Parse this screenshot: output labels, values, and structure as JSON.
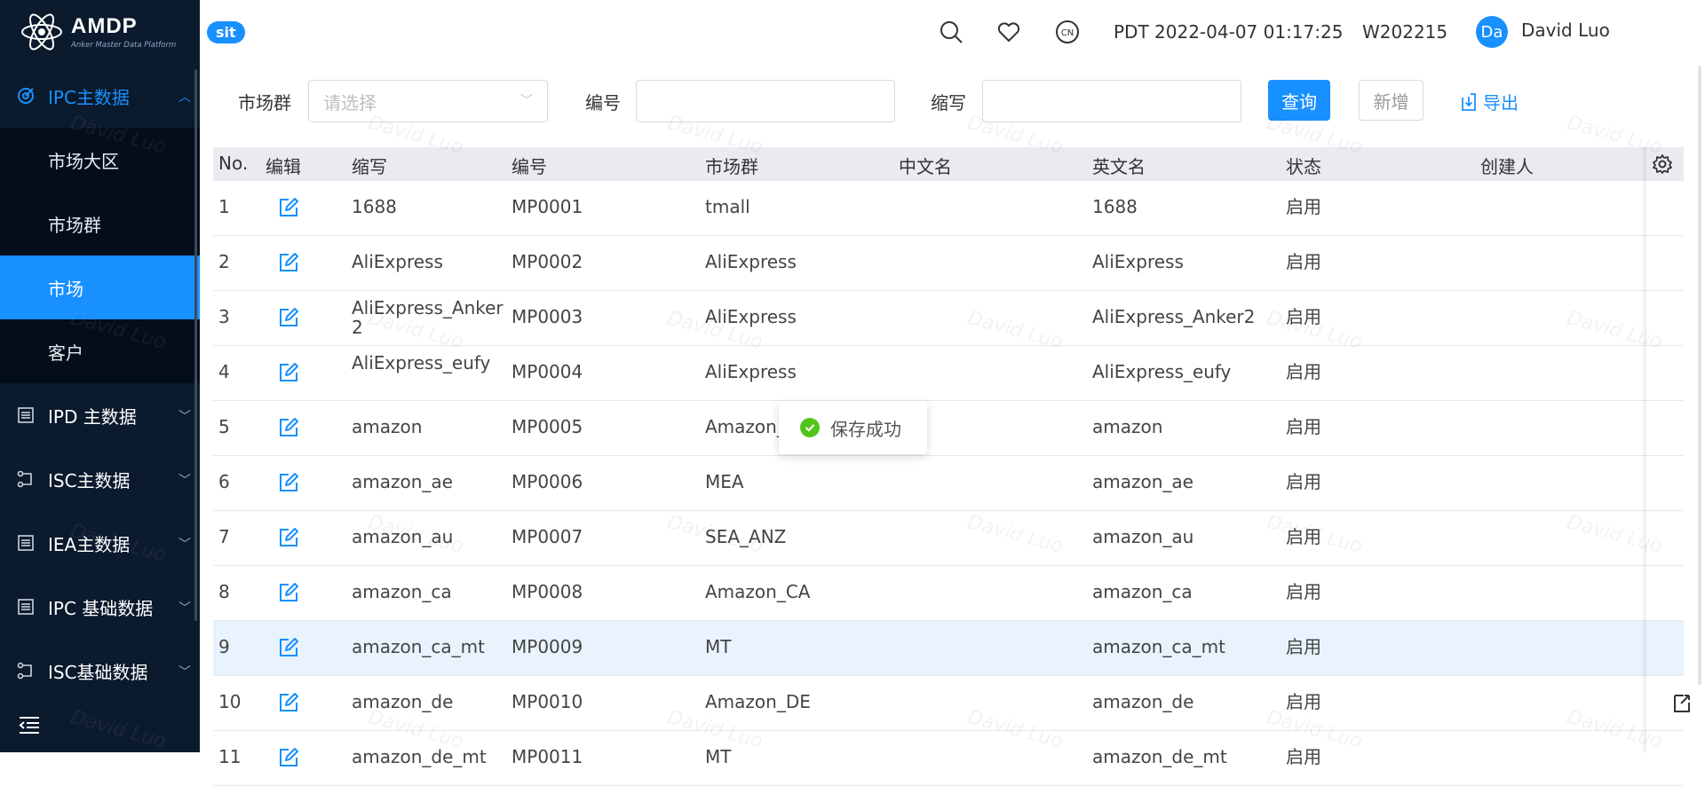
{
  "app": {
    "logo_title": "AMDP",
    "logo_subtitle": "Anker Master Data Platform",
    "env_badge": "sit",
    "accent_color": "#1890ff",
    "sidebar_bg": "#0b1a2c"
  },
  "header": {
    "datetime": "PDT 2022-04-07 01:17:25",
    "week": "W202215",
    "avatar_initials": "Da",
    "user_name": "David Luo",
    "lang_icon_text": "CN"
  },
  "sidebar": {
    "groups": [
      {
        "label": "IPC主数据",
        "icon": "target-icon",
        "expanded": true
      },
      {
        "label": "IPD 主数据",
        "icon": "list-icon"
      },
      {
        "label": "ISC主数据",
        "icon": "flow-icon"
      },
      {
        "label": "IEA主数据",
        "icon": "list-icon"
      },
      {
        "label": "IPC 基础数据",
        "icon": "list-icon"
      },
      {
        "label": "ISC基础数据",
        "icon": "flow-icon"
      }
    ],
    "sub_items": [
      {
        "label": "市场大区"
      },
      {
        "label": "市场群"
      },
      {
        "label": "市场",
        "selected": true
      },
      {
        "label": "客户"
      }
    ]
  },
  "filters": {
    "market_group_label": "市场群",
    "market_group_placeholder": "请选择",
    "code_label": "编号",
    "code_value": "",
    "abbr_label": "缩写",
    "abbr_value": "",
    "search_button": "查询",
    "add_button": "新增",
    "export_button": "导出"
  },
  "table": {
    "headers": [
      "No.",
      "编辑",
      "缩写",
      "编号",
      "市场群",
      "中文名",
      "英文名",
      "状态",
      "创建人"
    ],
    "rows": [
      {
        "no": "1",
        "abbr": "1688",
        "code": "MP0001",
        "group": "tmall",
        "cn": "",
        "en": "1688",
        "status": "启用",
        "creator": ""
      },
      {
        "no": "2",
        "abbr": "AliExpress",
        "code": "MP0002",
        "group": "AliExpress",
        "cn": "",
        "en": "AliExpress",
        "status": "启用",
        "creator": ""
      },
      {
        "no": "3",
        "abbr": "AliExpress_Anker2",
        "code": "MP0003",
        "group": "AliExpress",
        "cn": "",
        "en": "AliExpress_Anker2",
        "status": "启用",
        "creator": ""
      },
      {
        "no": "4",
        "abbr": "AliExpress_eufy",
        "code": "MP0004",
        "group": "AliExpress",
        "cn": "",
        "en": "AliExpress_eufy",
        "status": "启用",
        "creator": ""
      },
      {
        "no": "5",
        "abbr": "amazon",
        "code": "MP0005",
        "group": "Amazon_",
        "cn": "",
        "en": "amazon",
        "status": "启用",
        "creator": ""
      },
      {
        "no": "6",
        "abbr": "amazon_ae",
        "code": "MP0006",
        "group": "MEA",
        "cn": "",
        "en": "amazon_ae",
        "status": "启用",
        "creator": ""
      },
      {
        "no": "7",
        "abbr": "amazon_au",
        "code": "MP0007",
        "group": "SEA_ANZ",
        "cn": "",
        "en": "amazon_au",
        "status": "启用",
        "creator": ""
      },
      {
        "no": "8",
        "abbr": "amazon_ca",
        "code": "MP0008",
        "group": "Amazon_CA",
        "cn": "",
        "en": "amazon_ca",
        "status": "启用",
        "creator": ""
      },
      {
        "no": "9",
        "abbr": "amazon_ca_mt",
        "code": "MP0009",
        "group": "MT",
        "cn": "",
        "en": "amazon_ca_mt",
        "status": "启用",
        "creator": "",
        "highlighted": true
      },
      {
        "no": "10",
        "abbr": "amazon_de",
        "code": "MP0010",
        "group": "Amazon_DE",
        "cn": "",
        "en": "amazon_de",
        "status": "启用",
        "creator": ""
      },
      {
        "no": "11",
        "abbr": "amazon_de_mt",
        "code": "MP0011",
        "group": "MT",
        "cn": "",
        "en": "amazon_de_mt",
        "status": "启用",
        "creator": ""
      }
    ]
  },
  "toast": {
    "message": "保存成功",
    "color": "#52c41a"
  },
  "watermark": "David Luo"
}
